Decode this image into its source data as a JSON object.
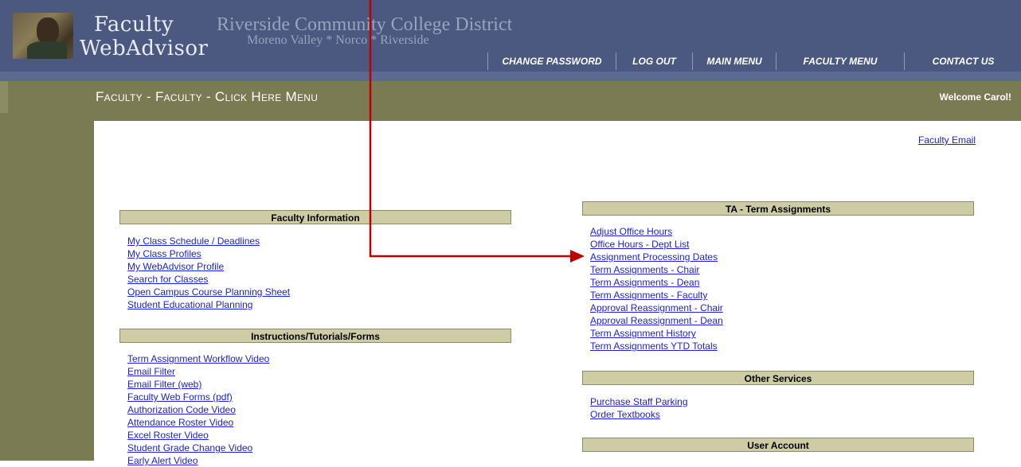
{
  "header": {
    "logo_line1": "Faculty",
    "logo_line2": "WebAdvisor",
    "college": "Riverside Community College District",
    "campuses": "Moreno Valley * Norco * Riverside",
    "nav": [
      "CHANGE PASSWORD",
      "LOG OUT",
      "MAIN MENU",
      "FACULTY MENU",
      "CONTACT US"
    ]
  },
  "title_bar": {
    "title": "Faculty - Faculty - Click Here Menu",
    "welcome": "Welcome Carol!"
  },
  "faculty_email": "Faculty Email",
  "sections": {
    "faculty_information": {
      "heading": "Faculty Information",
      "links": [
        "My Class Schedule / Deadlines",
        "My Class Profiles",
        "My WebAdvisor Profile",
        "Search for Classes",
        "Open Campus Course Planning Sheet",
        "Student Educational Planning"
      ]
    },
    "instructions": {
      "heading": "Instructions/Tutorials/Forms",
      "links": [
        "Term Assignment Workflow Video",
        "Email Filter",
        "Email Filter (web)",
        "Faculty Web Forms (pdf)",
        "Authorization Code Video",
        "Attendance Roster Video",
        "Excel Roster Video",
        "Student Grade Change Video",
        "Early Alert Video"
      ]
    },
    "term_assignments": {
      "heading": "TA - Term Assignments",
      "links": [
        "Adjust Office Hours",
        "Office Hours - Dept List",
        "Assignment Processing Dates",
        "Term Assignments - Chair",
        "Term Assignments - Dean",
        "Term Assignments - Faculty",
        "Approval Reassignment - Chair",
        "Approval Reassignment - Dean",
        "Term Assignment History",
        "Term Assignments YTD Totals"
      ]
    },
    "other_services": {
      "heading": "Other Services",
      "links": [
        "Purchase Staff Parking",
        "Order Textbooks"
      ]
    },
    "user_account": {
      "heading": "User Account"
    }
  },
  "colors": {
    "header_blue": "#4b5980",
    "olive": "#7a7b52",
    "section_bg": "#cdcca4",
    "link": "#1a1fe0",
    "annotation_arrow": "#c00000"
  },
  "icons": [
    "faculty-photo-icon",
    "annotation-arrow-icon"
  ]
}
